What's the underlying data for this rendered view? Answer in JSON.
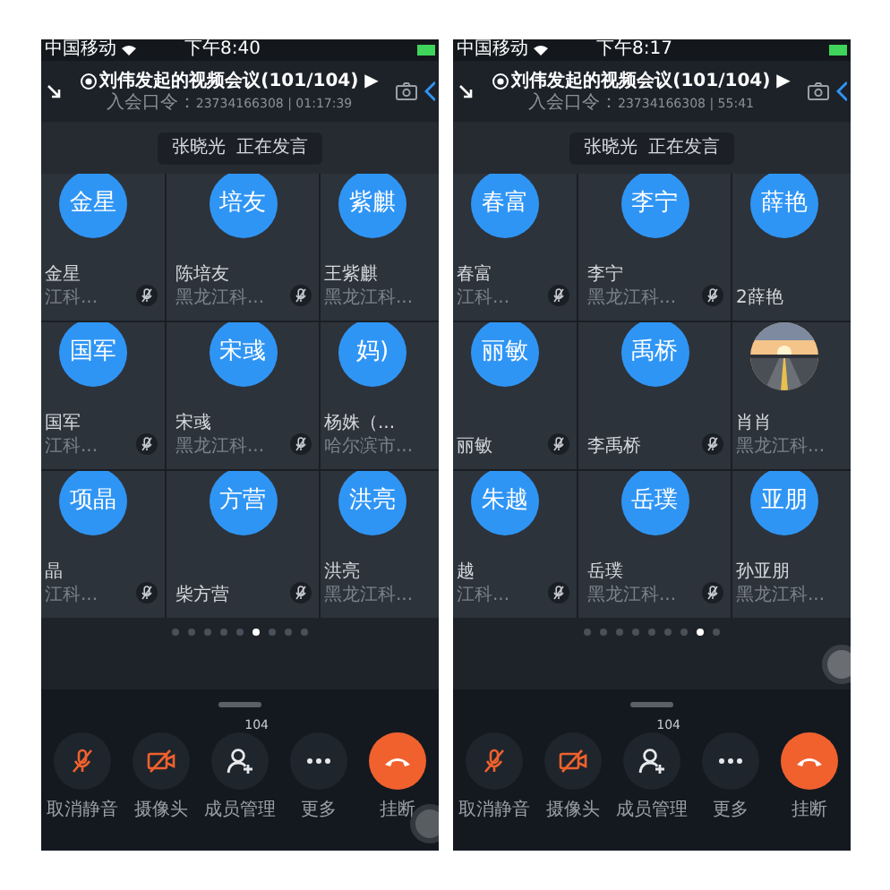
{
  "phones": [
    {
      "status_bar": {
        "carrier": "中国移动",
        "time": "下午8:40"
      },
      "header": {
        "title": "刘伟发起的视频会议(101/104) ▶",
        "code_label": "入会口令：",
        "code": "23734166308 | 01:17:39"
      },
      "speaker_toast": {
        "name": "张晓光",
        "status": "正在发言"
      },
      "tiles": [
        {
          "avatar": "金星",
          "kind": "initials",
          "name": "金星",
          "org": "江科...",
          "muted": true
        },
        {
          "avatar": "培友",
          "kind": "initials",
          "name": "陈培友",
          "org": "黑龙江科...",
          "muted": true
        },
        {
          "avatar": "紫麒",
          "kind": "initials",
          "name": "王紫麒",
          "org": "黑龙江科...",
          "muted": false
        },
        {
          "avatar": "国军",
          "kind": "initials",
          "name": "国军",
          "org": "江科...",
          "muted": true
        },
        {
          "avatar": "宋彧",
          "kind": "initials",
          "name": "宋彧",
          "org": "黑龙江科...",
          "muted": true
        },
        {
          "avatar": "妈)",
          "kind": "initials",
          "name": "杨姝（...",
          "org": "哈尔滨市...",
          "muted": false
        },
        {
          "avatar": "项晶",
          "kind": "initials",
          "name": "晶",
          "org": "江科...",
          "muted": true
        },
        {
          "avatar": "方营",
          "kind": "initials",
          "name": "柴方营",
          "muted": true
        },
        {
          "avatar": "洪亮",
          "kind": "initials",
          "name": "洪亮",
          "org": "黑龙江科...",
          "muted": false
        }
      ],
      "pager": [
        {
          "selected": false
        },
        {
          "selected": false
        },
        {
          "selected": false
        },
        {
          "selected": false
        },
        {
          "selected": false
        },
        {
          "selected": true
        },
        {
          "selected": false
        },
        {
          "selected": false
        },
        {
          "selected": false
        }
      ],
      "floating_button": {
        "kind": "bottom"
      },
      "toolbar": [
        {
          "kind": "mic_off",
          "label": "取消静音"
        },
        {
          "kind": "camera_off",
          "label": "摄像头"
        },
        {
          "kind": "members",
          "label": "成员管理",
          "badge": "104"
        },
        {
          "kind": "more",
          "label": "更多"
        },
        {
          "kind": "hangup",
          "label": "挂断"
        }
      ]
    },
    {
      "status_bar": {
        "carrier": "中国移动",
        "time": "下午8:17"
      },
      "header": {
        "title": "刘伟发起的视频会议(101/104) ▶",
        "code_label": "入会口令：",
        "code": "23734166308 | 55:41"
      },
      "speaker_toast": {
        "name": "张晓光",
        "status": "正在发言"
      },
      "tiles": [
        {
          "avatar": "春富",
          "kind": "initials",
          "name": "春富",
          "org": "江科...",
          "muted": true
        },
        {
          "avatar": "李宁",
          "kind": "initials",
          "name": "李宁",
          "org": "黑龙江科...",
          "muted": true
        },
        {
          "avatar": "薛艳",
          "kind": "initials",
          "name": "2薛艳",
          "muted": false
        },
        {
          "avatar": "丽敏",
          "kind": "initials",
          "name": "丽敏",
          "muted": true
        },
        {
          "avatar": "禹桥",
          "kind": "initials",
          "name": "李禹桥",
          "muted": true
        },
        {
          "kind": "picture",
          "name": "肖肖",
          "org": "黑龙江科...",
          "muted": false
        },
        {
          "avatar": "朱越",
          "kind": "initials",
          "name": "越",
          "org": "江科...",
          "muted": true
        },
        {
          "avatar": "岳璞",
          "kind": "initials",
          "name": "岳璞",
          "org": "黑龙江科...",
          "muted": true
        },
        {
          "avatar": "亚朋",
          "kind": "initials",
          "name": "孙亚朋",
          "org": "黑龙江科...",
          "muted": false
        }
      ],
      "pager": [
        {
          "selected": false
        },
        {
          "selected": false
        },
        {
          "selected": false
        },
        {
          "selected": false
        },
        {
          "selected": false
        },
        {
          "selected": false
        },
        {
          "selected": false
        },
        {
          "selected": true
        },
        {
          "selected": false
        }
      ],
      "floating_button": {
        "kind": "middle"
      },
      "toolbar": [
        {
          "kind": "mic_off",
          "label": "取消静音"
        },
        {
          "kind": "camera_off",
          "label": "摄像头"
        },
        {
          "kind": "members",
          "label": "成员管理",
          "badge": "104"
        },
        {
          "kind": "more",
          "label": "更多"
        },
        {
          "kind": "hangup",
          "label": "挂断"
        }
      ]
    }
  ]
}
